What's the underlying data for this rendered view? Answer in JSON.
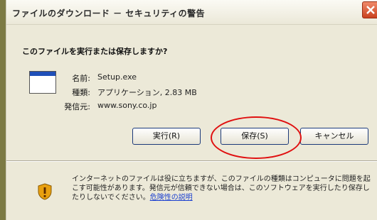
{
  "dialog": {
    "title": "ファイルのダウンロード － セキュリティの警告",
    "question": "このファイルを実行または保存しますか?",
    "file": {
      "name_label": "名前:",
      "name_value": "Setup.exe",
      "type_label": "種類:",
      "type_value": "アプリケーション, 2.83 MB",
      "source_label": "発信元:",
      "source_value": "www.sony.co.jp"
    },
    "buttons": {
      "run": "実行(R)",
      "save": "保存(S)",
      "cancel": "キャンセル"
    },
    "warning": {
      "text": "インターネットのファイルは役に立ちますが、このファイルの種類はコンピュータに問題を起こす可能性があります。発信元が信頼できない場合は、このソフトウェアを実行したり保存したりしないでください。",
      "link": "危険性の説明"
    }
  }
}
